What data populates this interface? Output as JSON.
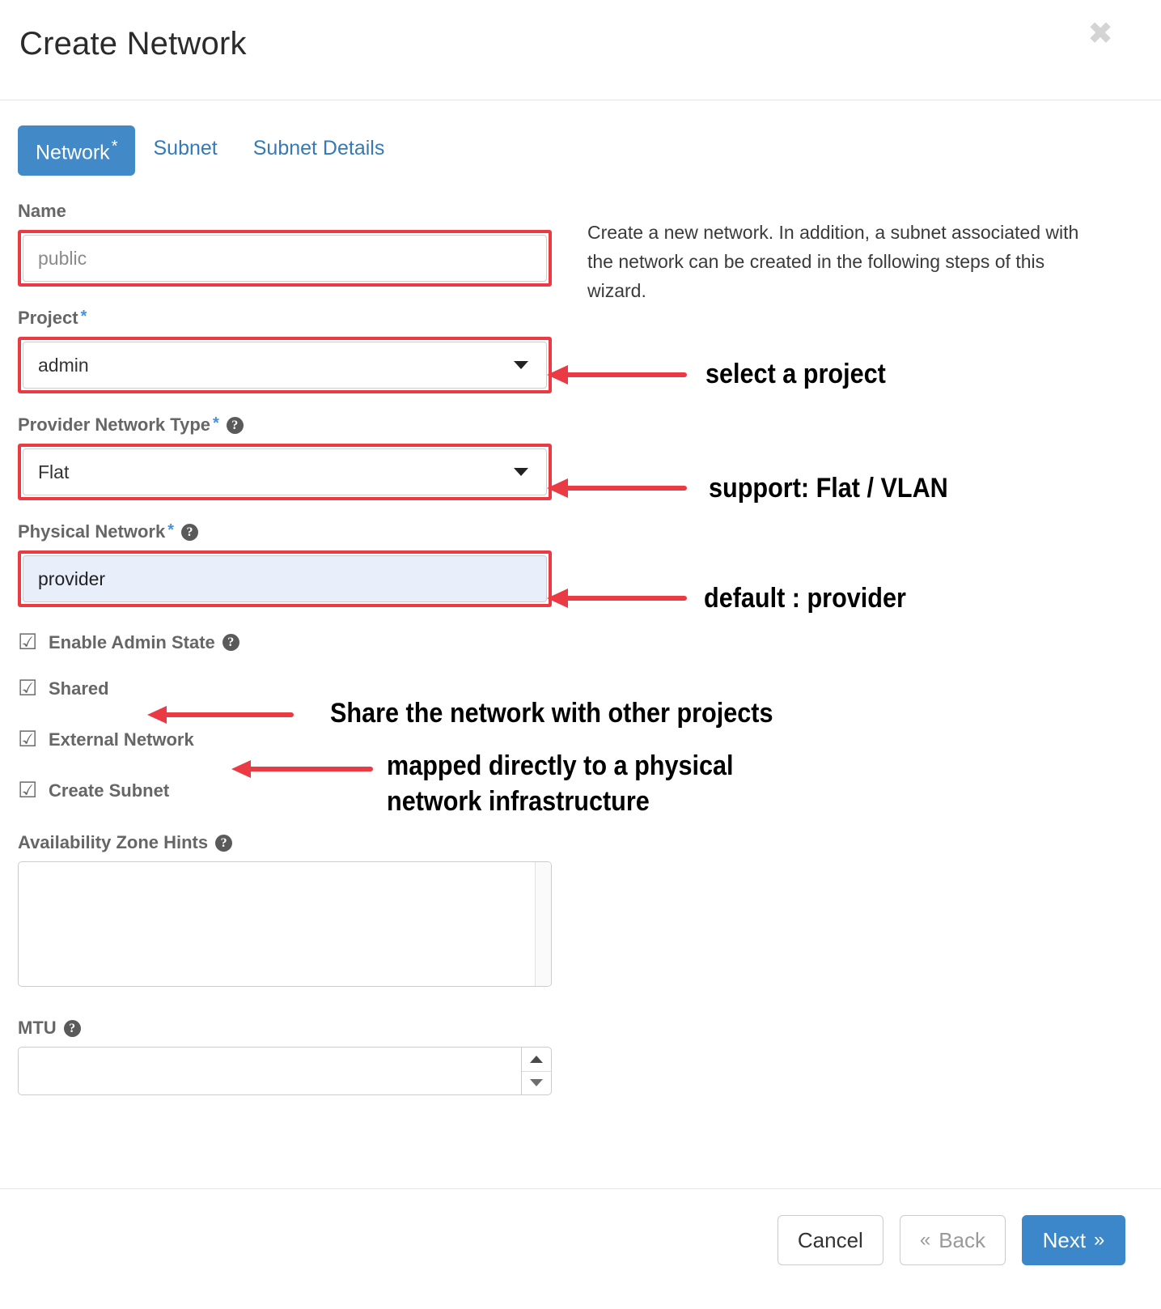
{
  "modal": {
    "title": "Create Network",
    "close_label": "✖"
  },
  "tabs": [
    {
      "label": "Network",
      "required": true,
      "active": true
    },
    {
      "label": "Subnet",
      "required": false,
      "active": false
    },
    {
      "label": "Subnet Details",
      "required": false,
      "active": false
    }
  ],
  "description": "Create a new network. In addition, a subnet associated with the network can be created in the following steps of this wizard.",
  "fields": {
    "name": {
      "label": "Name",
      "value": "public",
      "is_placeholder": true,
      "required": false
    },
    "project": {
      "label": "Project",
      "value": "admin",
      "required": true
    },
    "provider_network_type": {
      "label": "Provider Network Type",
      "value": "Flat",
      "required": true,
      "help": "?"
    },
    "physical_network": {
      "label": "Physical Network",
      "value": "provider",
      "required": true,
      "help": "?"
    },
    "availability_zone_hints": {
      "label": "Availability Zone Hints",
      "value": "",
      "help": "?"
    },
    "mtu": {
      "label": "MTU",
      "value": "",
      "help": "?"
    }
  },
  "checkboxes": [
    {
      "label": "Enable Admin State",
      "checked": true,
      "glyph": "☑",
      "help": "?"
    },
    {
      "label": "Shared",
      "checked": true,
      "glyph": "☑",
      "help": ""
    },
    {
      "label": "External Network",
      "checked": true,
      "glyph": "☑",
      "help": ""
    },
    {
      "label": "Create Subnet",
      "checked": true,
      "glyph": "☑",
      "help": ""
    }
  ],
  "annotations": [
    {
      "id": "project-note",
      "text": "select a project"
    },
    {
      "id": "network-type-note",
      "text": "support: Flat / VLAN"
    },
    {
      "id": "physical-network-note",
      "text": "default : provider"
    },
    {
      "id": "shared-note",
      "text": "Share the network with other projects"
    },
    {
      "id": "external-note",
      "text": "mapped directly to a physical\nnetwork infrastructure"
    }
  ],
  "footer": {
    "cancel_label": "Cancel",
    "back_label": "Back",
    "back_chevron": "«",
    "next_label": "Next",
    "next_chevron": "»"
  },
  "colors": {
    "accent": "#3b87c9",
    "tab_active": "#4189c7",
    "link": "#337ab7",
    "annotation_red": "#ea3b44",
    "autofill_bg": "#e8eefa",
    "label_gray": "#666666"
  }
}
